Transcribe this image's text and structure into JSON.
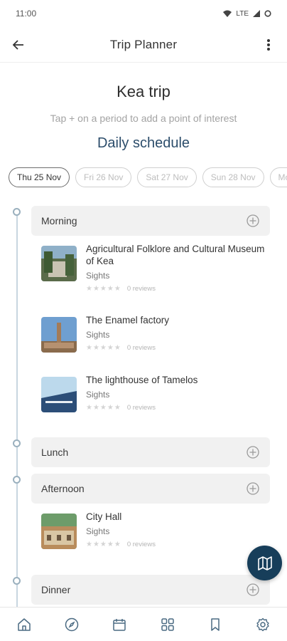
{
  "status": {
    "time": "11:00",
    "network": "LTE"
  },
  "header": {
    "title": "Trip Planner"
  },
  "trip": {
    "name": "Kea trip",
    "hint": "Tap + on a period to add a point of interest",
    "section_title": "Daily schedule"
  },
  "dates": [
    "Thu 25 Nov",
    "Fri 26 Nov",
    "Sat 27 Nov",
    "Sun 28 Nov",
    "Mo"
  ],
  "active_date_index": 0,
  "periods": {
    "morning": "Morning",
    "lunch": "Lunch",
    "afternoon": "Afternoon",
    "dinner": "Dinner"
  },
  "pois": [
    {
      "name": "Agricultural Folklore and Cultural Museum of Kea",
      "category": "Sights",
      "reviews": "0 reviews",
      "rating": 0
    },
    {
      "name": "The Enamel factory",
      "category": "Sights",
      "reviews": "0 reviews",
      "rating": 0
    },
    {
      "name": "The lighthouse of Tamelos",
      "category": "Sights",
      "reviews": "0 reviews",
      "rating": 0
    },
    {
      "name": "City Hall",
      "category": "Sights",
      "reviews": "0 reviews",
      "rating": 0
    }
  ],
  "icons": {
    "back": "arrow-left-icon",
    "menu": "more-vertical-icon",
    "add": "plus-circle-icon",
    "map": "map-icon",
    "nav": [
      "home-icon",
      "compass-icon",
      "calendar-icon",
      "grid-icon",
      "bookmark-icon",
      "settings-icon"
    ]
  },
  "colors": {
    "accent": "#173e5a",
    "title": "#2c4d6b",
    "timeline": "#c8d6e0"
  }
}
